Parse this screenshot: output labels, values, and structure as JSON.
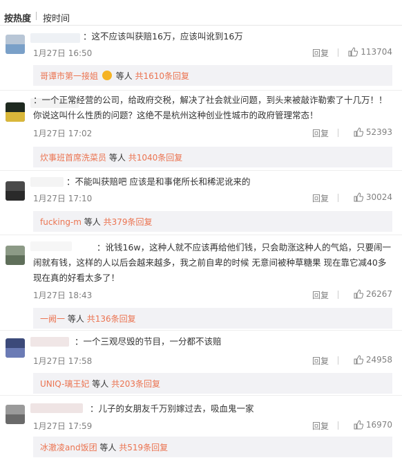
{
  "sort_tabs": {
    "hot": "按热度",
    "time": "按时间"
  },
  "colors": {
    "accent": "#eb7350",
    "meta": "#808080",
    "reply_bg": "#f2f2f5"
  },
  "comments": [
    {
      "text": "：这不应该叫获赔16万，应该叫讹到16万",
      "time": "1月27日 16:50",
      "reply_label": "回复",
      "likes": "113704",
      "replies": {
        "name": "哥谭市第一接姐",
        "mid": "等人",
        "count": "共1610条回复"
      }
    },
    {
      "text": "：一个正常经营的公司，给政府交税，解决了社会就业问题，到头来被敲诈勒索了十几万！！你说这叫什么性质的问题？这绝不是杭州这种创业性城市的政府管理常态！",
      "time": "1月27日 17:02",
      "reply_label": "回复",
      "likes": "52393",
      "replies": {
        "name": "炊事班首席洗菜员",
        "mid": "等人",
        "count": "共1040条回复"
      }
    },
    {
      "text": "：不能叫获赔吧  应该是和事佬所长和稀泥讹来的",
      "time": "1月27日 17:10",
      "reply_label": "回复",
      "likes": "30024",
      "replies": {
        "name": "fucking-m",
        "mid": "等人",
        "count": "共379条回复"
      }
    },
    {
      "text": "：讹钱16w，这种人就不应该再给他们钱，只会助涨这种人的气焰，只要闹一闹就有钱，这样的人以后会越来越多，我之前自卑的时候 无意间被种草糖果 现在靠它减40多 现在真的好看太多了！",
      "time": "1月27日 18:43",
      "reply_label": "回复",
      "likes": "26267",
      "replies": {
        "name": "一阙一",
        "mid": "等人",
        "count": "共136条回复"
      }
    },
    {
      "text": "：一个三观尽毁的节目，一分都不该赔",
      "time": "1月27日 17:58",
      "reply_label": "回复",
      "likes": "24958",
      "replies": {
        "name": "UNIQ-璃王妃",
        "mid": "等人",
        "count": "共203条回复"
      }
    },
    {
      "text": "：儿子的女朋友千万别嫁过去，吸血鬼一家",
      "time": "1月27日 17:59",
      "reply_label": "回复",
      "likes": "16970",
      "replies": {
        "name": "冰澈凌and饭团",
        "mid": "等人",
        "count": "共519条回复"
      }
    }
  ]
}
